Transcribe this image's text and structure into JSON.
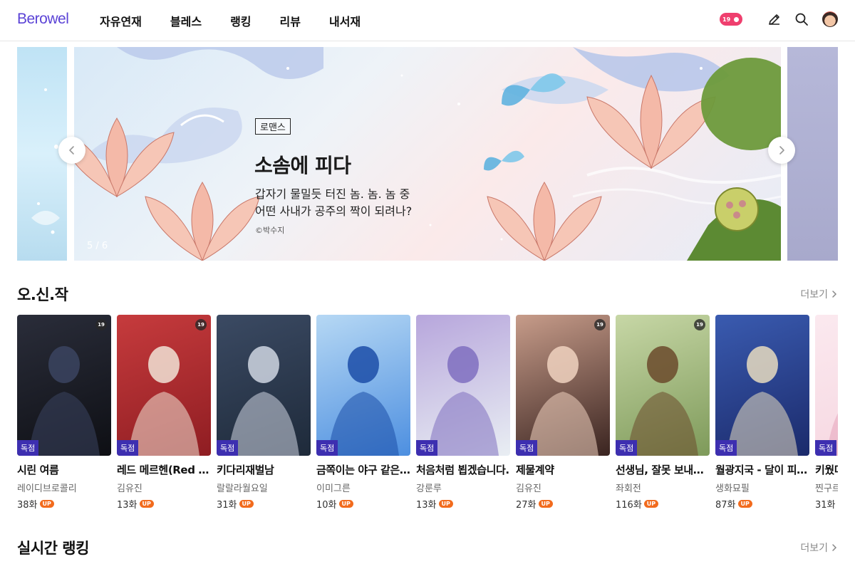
{
  "header": {
    "logo": "Berowel",
    "nav": [
      "자유연재",
      "블레스",
      "랭킹",
      "리뷰",
      "내서재"
    ],
    "adult_badge": "19",
    "colors": {
      "brand": "#5b43d6",
      "adult": "#ef3f6e"
    }
  },
  "banner": {
    "genre": "로맨스",
    "title": "소솜에 피다",
    "desc_line1": "갑자기 물밀듯 터진 놈. 놈. 놈 중",
    "desc_line2": "어떤 사내가 공주의 짝이 되려나?",
    "copyright": "©박수지",
    "counter": "5 / 6",
    "prev_icon": "chevron-left-icon",
    "next_icon": "chevron-right-icon"
  },
  "section_new": {
    "title": "오.신.작",
    "more": "더보기"
  },
  "section_rank": {
    "title": "실시간 랭킹",
    "more": "더보기"
  },
  "exclusive_label": "독점",
  "up_label": "UP",
  "adult_mark": "19",
  "episode_suffix": "화",
  "cards": [
    {
      "title": "시린 여름",
      "author": "레이디브로콜리",
      "episodes": "38",
      "adult": true,
      "c1": "#0e0f14",
      "c2": "#2a2d3a",
      "accent": "#3b4460"
    },
    {
      "title": "레드 메르헨(Red Märchen)",
      "author": "김유진",
      "episodes": "13",
      "adult": true,
      "c1": "#8f1d22",
      "c2": "#c63b3d",
      "accent": "#f1e3d6"
    },
    {
      "title": "키다리재벌남",
      "author": "랄랄라월요일",
      "episodes": "31",
      "adult": false,
      "c1": "#1e2a3a",
      "c2": "#3b4a63",
      "accent": "#cfd6e2"
    },
    {
      "title": "금쪽이는 야구 같은 걸 해요",
      "author": "이미그른",
      "episodes": "10",
      "adult": false,
      "c1": "#4d8fe0",
      "c2": "#b6d8f4",
      "accent": "#1c4ea8"
    },
    {
      "title": "처음처럼 뵙겠습니다.",
      "author": "강룬루",
      "episodes": "13",
      "adult": false,
      "c1": "#e9eef3",
      "c2": "#b7a6dc",
      "accent": "#7f6fc0"
    },
    {
      "title": "제물계약",
      "author": "김유진",
      "episodes": "27",
      "adult": true,
      "c1": "#3a2420",
      "c2": "#c79c8a",
      "accent": "#f0d2c0"
    },
    {
      "title": "선생님, 잘못 보내셨어요",
      "author": "좌회전",
      "episodes": "116",
      "adult": true,
      "c1": "#7e9a5a",
      "c2": "#c7d7a6",
      "accent": "#6b4a2b"
    },
    {
      "title": "월광지국 - 달이 피는 나라",
      "author": "생화묘필",
      "episodes": "87",
      "adult": false,
      "c1": "#1b2a6b",
      "c2": "#3a5bb0",
      "accent": "#e7dcc0"
    },
    {
      "title": "키웠더니",
      "author": "찐구르",
      "episodes": "31",
      "adult": false,
      "c1": "#f6d6e0",
      "c2": "#fbe9ef",
      "accent": "#e5a4bb"
    }
  ]
}
